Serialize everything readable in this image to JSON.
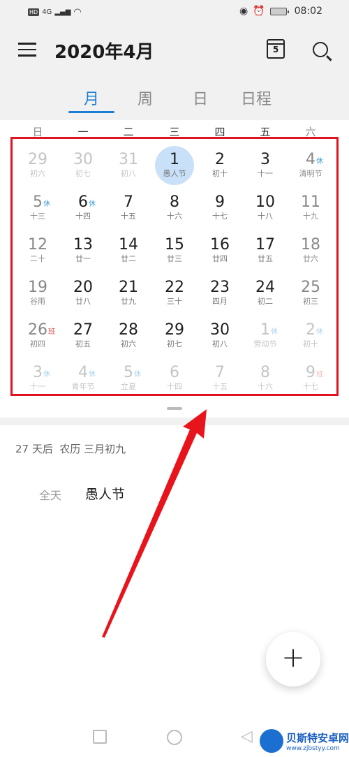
{
  "status_bar": {
    "network": "4G",
    "hd": "HD",
    "time": "08:02"
  },
  "header": {
    "title": "2020年4月",
    "today_icon_day": "5"
  },
  "tabs": [
    {
      "label": "月",
      "active": true
    },
    {
      "label": "周"
    },
    {
      "label": "日"
    },
    {
      "label": "日程"
    }
  ],
  "weekdays": [
    "日",
    "一",
    "二",
    "三",
    "四",
    "五",
    "六"
  ],
  "calendar": {
    "rows": [
      [
        {
          "d": "29",
          "l": "初六",
          "s": "other"
        },
        {
          "d": "30",
          "l": "初七",
          "s": "other"
        },
        {
          "d": "31",
          "l": "初八",
          "s": "other"
        },
        {
          "d": "1",
          "l": "愚人节",
          "s": "normal",
          "selected": true
        },
        {
          "d": "2",
          "l": "初十",
          "s": "normal"
        },
        {
          "d": "3",
          "l": "十一",
          "s": "normal"
        },
        {
          "d": "4",
          "l": "清明节",
          "s": "weekend",
          "b": "休"
        }
      ],
      [
        {
          "d": "5",
          "l": "十三",
          "s": "weekend",
          "b": "休"
        },
        {
          "d": "6",
          "l": "十四",
          "s": "normal",
          "b": "休"
        },
        {
          "d": "7",
          "l": "十五",
          "s": "normal"
        },
        {
          "d": "8",
          "l": "十六",
          "s": "normal"
        },
        {
          "d": "9",
          "l": "十七",
          "s": "normal"
        },
        {
          "d": "10",
          "l": "十八",
          "s": "normal"
        },
        {
          "d": "11",
          "l": "十九",
          "s": "weekend"
        }
      ],
      [
        {
          "d": "12",
          "l": "二十",
          "s": "weekend"
        },
        {
          "d": "13",
          "l": "廿一",
          "s": "normal"
        },
        {
          "d": "14",
          "l": "廿二",
          "s": "normal"
        },
        {
          "d": "15",
          "l": "廿三",
          "s": "normal"
        },
        {
          "d": "16",
          "l": "廿四",
          "s": "normal"
        },
        {
          "d": "17",
          "l": "廿五",
          "s": "normal"
        },
        {
          "d": "18",
          "l": "廿六",
          "s": "weekend"
        }
      ],
      [
        {
          "d": "19",
          "l": "谷雨",
          "s": "weekend"
        },
        {
          "d": "20",
          "l": "廿八",
          "s": "normal"
        },
        {
          "d": "21",
          "l": "廿九",
          "s": "normal"
        },
        {
          "d": "22",
          "l": "三十",
          "s": "normal"
        },
        {
          "d": "23",
          "l": "四月",
          "s": "normal"
        },
        {
          "d": "24",
          "l": "初二",
          "s": "normal"
        },
        {
          "d": "25",
          "l": "初三",
          "s": "weekend"
        }
      ],
      [
        {
          "d": "26",
          "l": "初四",
          "s": "weekend",
          "b": "班"
        },
        {
          "d": "27",
          "l": "初五",
          "s": "normal"
        },
        {
          "d": "28",
          "l": "初六",
          "s": "normal"
        },
        {
          "d": "29",
          "l": "初七",
          "s": "normal"
        },
        {
          "d": "30",
          "l": "初八",
          "s": "normal"
        },
        {
          "d": "1",
          "l": "劳动节",
          "s": "other",
          "b": "休"
        },
        {
          "d": "2",
          "l": "初十",
          "s": "other",
          "b": "休"
        }
      ],
      [
        {
          "d": "3",
          "l": "十一",
          "s": "other",
          "b": "休"
        },
        {
          "d": "4",
          "l": "青年节",
          "s": "other",
          "b": "休"
        },
        {
          "d": "5",
          "l": "立夏",
          "s": "other",
          "b": "休"
        },
        {
          "d": "6",
          "l": "十四",
          "s": "other"
        },
        {
          "d": "7",
          "l": "十五",
          "s": "other"
        },
        {
          "d": "8",
          "l": "十六",
          "s": "other"
        },
        {
          "d": "9",
          "l": "十七",
          "s": "other",
          "b": "班"
        }
      ]
    ]
  },
  "colors": {
    "accent": "#1a7fd4",
    "rest_badge": "#3a9ad9",
    "work_badge": "#d9534f",
    "highlight_box": "#e0141e",
    "selected_day": "#c9e1f8"
  },
  "detail": {
    "summary": "27 天后  农历 三月初九",
    "all_day": "全天",
    "event": "愚人节"
  },
  "fab": {
    "label": "+"
  },
  "watermark": {
    "name": "贝斯特安卓网",
    "url": "www.zjbstyy.com"
  }
}
